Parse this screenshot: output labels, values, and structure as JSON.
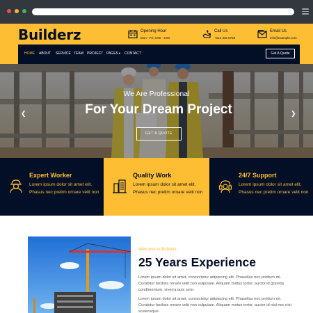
{
  "browser": {
    "icon": "hamburger-menu-icon"
  },
  "header": {
    "logo": "Builderz",
    "opening": {
      "icon": "calendar-icon",
      "title": "Opening Hour",
      "value": "Mon - Fri, 8:00 - 9:00"
    },
    "call": {
      "icon": "phone-hand-icon",
      "title": "Call Us",
      "value": "+012 345 6789"
    },
    "email": {
      "icon": "envelope-icon",
      "title": "Email Us",
      "value": "info@example.com"
    }
  },
  "nav": {
    "items": [
      "HOME",
      "ABOUT",
      "SERVICE",
      "TEAM",
      "PROJECT",
      "PAGES",
      "CONTACT"
    ],
    "quote_button": "Get A Quote"
  },
  "hero": {
    "subtitle": "We Are Professional",
    "title": "For Your Dream Project",
    "button": "GET A QUOTE"
  },
  "features": [
    {
      "icon": "worker-icon",
      "title": "Expert Worker",
      "desc": "Lorem ipsum dolor sit amet elit. Phasus nec pretim ornare velit non"
    },
    {
      "icon": "building-icon",
      "title": "Quality Work",
      "desc": "Lorem ipsum dolor sit amet elit. Phasus nec pretim ornare velit non"
    },
    {
      "icon": "support-icon",
      "title": "24/7 Support",
      "desc": "Lorem ipsum dolor sit amet elit. Phasus nec pretim ornare velit non"
    }
  ],
  "about": {
    "kicker": "Welcome to Builderz",
    "title": "25 Years Experience",
    "p1": "Lorem ipsum dolor sit amet, consectetur adipiscing elit. Phasellus nec pretium mi. Curabitur facilisis ornare velit non vulputate. Aliquam metus tortor, auctor id gravida condimentum, viverra quis sem.",
    "p2": "Lorem ipsum dolor sit amet, consectetur adipiscing elit. Phasellus nec pretium mi. Curabitur facilisis ornare velit non vulputate. Aliquam metus tortor, auctor id nisl nec nisi scelerisque"
  },
  "colors": {
    "accent": "#fdbe33",
    "dark": "#030f27"
  }
}
